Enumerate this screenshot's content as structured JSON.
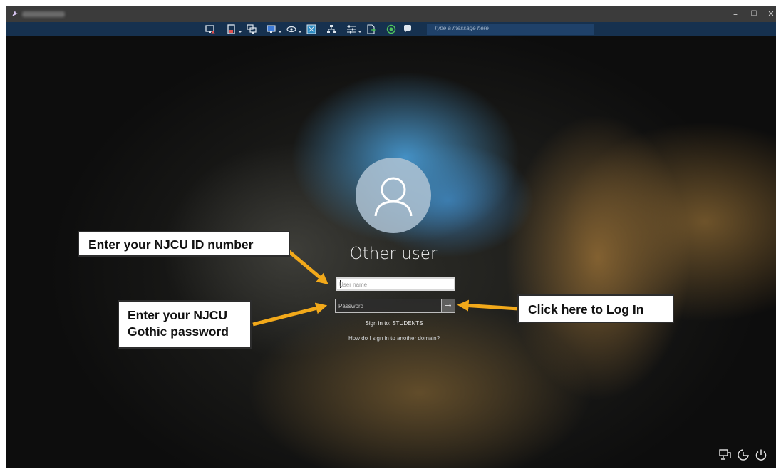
{
  "window": {
    "title": "",
    "controls": {
      "minimize": "–",
      "maximize": "☐",
      "close": "✕"
    }
  },
  "toolbar": {
    "icons": [
      "monitor-close-icon",
      "clipboard-icon",
      "multi-monitor-icon",
      "display-icon",
      "view-eye-icon",
      "fullscreen-icon",
      "network-icon",
      "settings-sliders-icon",
      "file-transfer-icon",
      "record-icon",
      "chat-icon"
    ],
    "message_placeholder": "Type a message here"
  },
  "login": {
    "user_label": "Other user",
    "username_placeholder": "User name",
    "password_placeholder": "Password",
    "submit_glyph": "→",
    "sign_in_to": "Sign in to: STUDENTS",
    "other_domain_link": "How do I sign in to another domain?"
  },
  "bottom_icons": [
    "network-icon",
    "accessibility-icon",
    "power-icon"
  ],
  "annotations": {
    "id_callout": "Enter your NJCU ID number",
    "password_callout_line1": "Enter your NJCU",
    "password_callout_line2": "Gothic password",
    "login_callout": "Click here to Log In",
    "arrow_color": "#f2a91a"
  },
  "colors": {
    "toolbar_bg": "#16314f",
    "titlebar_bg": "#3b3b3b",
    "callout_border": "#2d2d2d"
  }
}
